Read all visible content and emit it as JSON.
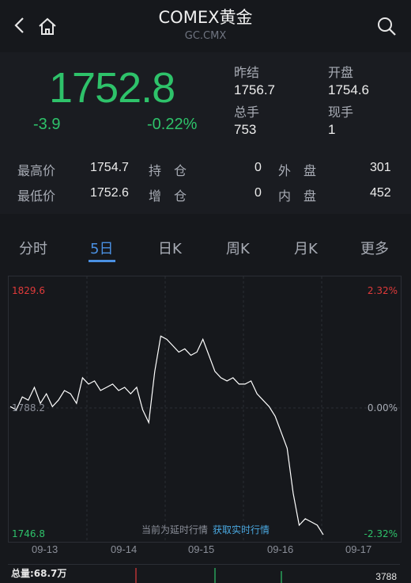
{
  "header": {
    "title": "COMEX黄金",
    "subtitle": "GC.CMX"
  },
  "quote": {
    "price": "1752.8",
    "change": "-3.9",
    "change_pct": "-0.22%",
    "prev_close_label": "昨结",
    "prev_close": "1756.7",
    "open_label": "开盘",
    "open": "1754.6",
    "volume_label": "总手",
    "volume": "753",
    "current_label": "现手",
    "current": "1"
  },
  "stats": {
    "high_label": "最高价",
    "high": "1754.7",
    "hold_label": "持　仓",
    "hold": "0",
    "outer_label": "外　盘",
    "outer": "301",
    "low_label": "最低价",
    "low": "1752.6",
    "add_label": "增　仓",
    "add": "0",
    "inner_label": "内　盘",
    "inner": "452"
  },
  "tabs": {
    "t1": "分时",
    "t2": "5日",
    "t3": "日K",
    "t4": "周K",
    "t5": "月K",
    "t6": "更多"
  },
  "chart_data": {
    "type": "line",
    "y_top": "1829.6",
    "y_mid": "1788.2",
    "y_bottom": "1746.8",
    "pct_top": "2.32%",
    "pct_mid": "0.00%",
    "pct_bottom": "-2.32%",
    "ylim": [
      1746.8,
      1829.6
    ],
    "x_labels": [
      "09-13",
      "09-14",
      "09-15",
      "09-16",
      "09-17"
    ],
    "delay_note": "当前为延时行情",
    "realtime_link": "获取实时行情",
    "series": [
      {
        "values": [
          1789,
          1788,
          1792,
          1791,
          1795,
          1790,
          1793,
          1789,
          1791,
          1794,
          1793,
          1790,
          1798,
          1796,
          1797,
          1794,
          1795,
          1796,
          1794,
          1795,
          1793,
          1795,
          1788,
          1784,
          1800,
          1811,
          1810,
          1808,
          1806,
          1807,
          1805,
          1806,
          1810,
          1805,
          1800,
          1798,
          1797,
          1798,
          1796,
          1796,
          1797,
          1793,
          1791,
          1789,
          1786,
          1781,
          1776,
          1762,
          1752,
          1754,
          1753,
          1752,
          1749
        ]
      }
    ]
  },
  "volume": {
    "total_label": "总量:68.7万",
    "max": "3788"
  },
  "colors": {
    "up": "#e03a3a",
    "down": "#2ec26a",
    "accent": "#4a90e2"
  }
}
